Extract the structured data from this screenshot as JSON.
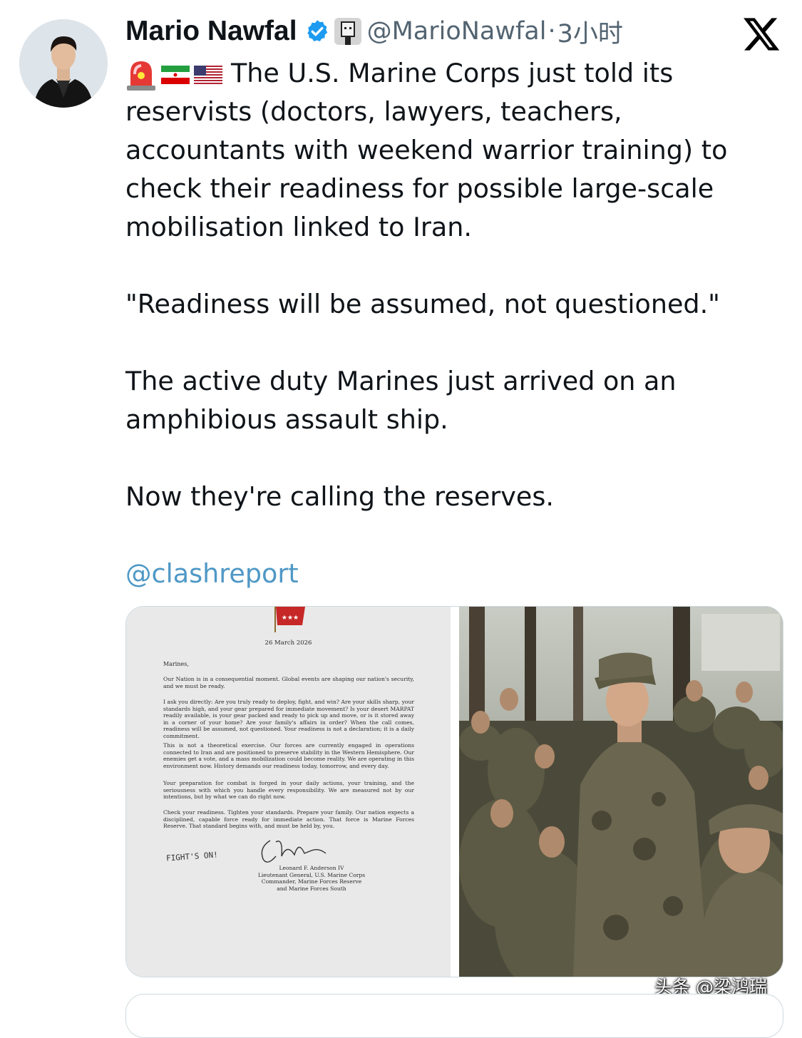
{
  "author": {
    "name": "Mario Nawfal",
    "handle": "@MarioNawfal",
    "separator": "·",
    "time": "3小时"
  },
  "tweet": {
    "line1": "The U.S. Marine Corps just told its",
    "line2": "reservists (doctors, lawyers, teachers,",
    "line3": "accountants with weekend warrior training) to",
    "line4": "check their readiness for possible large-scale",
    "line5": "mobilisation linked to Iran.",
    "quote": "\"Readiness will be assumed, not questioned.\"",
    "p3_line1": "The active duty Marines just arrived on an",
    "p3_line2": "amphibious assault ship.",
    "p4": "Now they're calling the reserves.",
    "mention": "@clashreport"
  },
  "document": {
    "date": "26 March 2026",
    "greeting": "Marines,",
    "para1": "Our Nation is in a consequential moment. Global events are shaping our nation's security, and we must be ready.",
    "para2": "I ask you directly: Are you truly ready to deploy, fight, and win? Are your skills sharp, your standards high, and your gear prepared for immediate movement? Is your desert MARPAT readily available, is your gear packed and ready to pick up and move, or is it stored away in a corner of your home? Are your family's affairs in order? When the call comes, readiness will be assumed, not questioned. Your readiness is not a declaration; it is a daily commitment.",
    "para3": "This is not a theoretical exercise. Our forces are currently engaged in operations connected to Iran and are positioned to preserve stability in the Western Hemisphere. Our enemies get a vote, and a mass mobilization could become reality. We are operating in this environment now. History demands our readiness today, tomorrow, and every day.",
    "para4": "Your preparation for combat is forged in your daily actions, your training, and the seriousness with which you handle every responsibility. We are measured not by our intentions, but by what we can do right now.",
    "para5": "Check your readiness. Tighten your standards. Prepare your family. Our nation expects a disciplined, capable force ready for immediate action. That force is Marine Forces Reserve. That standard begins with, and must be held by, you.",
    "handwritten": "FIGHT'S ON!",
    "sig_name": "Leonard F. Anderson IV",
    "sig_title1": "Lieutenant General, U.S. Marine Corps",
    "sig_title2": "Commander, Marine Forces Reserve",
    "sig_title3": "and Marine Forces South"
  },
  "watermark": "头条 @梁鸿瑞",
  "colors": {
    "text": "#0f1419",
    "secondary": "#536471",
    "verified": "#1d9bf0",
    "link": "#4f98c6",
    "border": "#cfd9de"
  },
  "icons": [
    "verified-badge-icon",
    "affiliate-badge-icon",
    "x-logo-icon",
    "siren-emoji",
    "iran-flag-emoji",
    "us-flag-emoji"
  ]
}
